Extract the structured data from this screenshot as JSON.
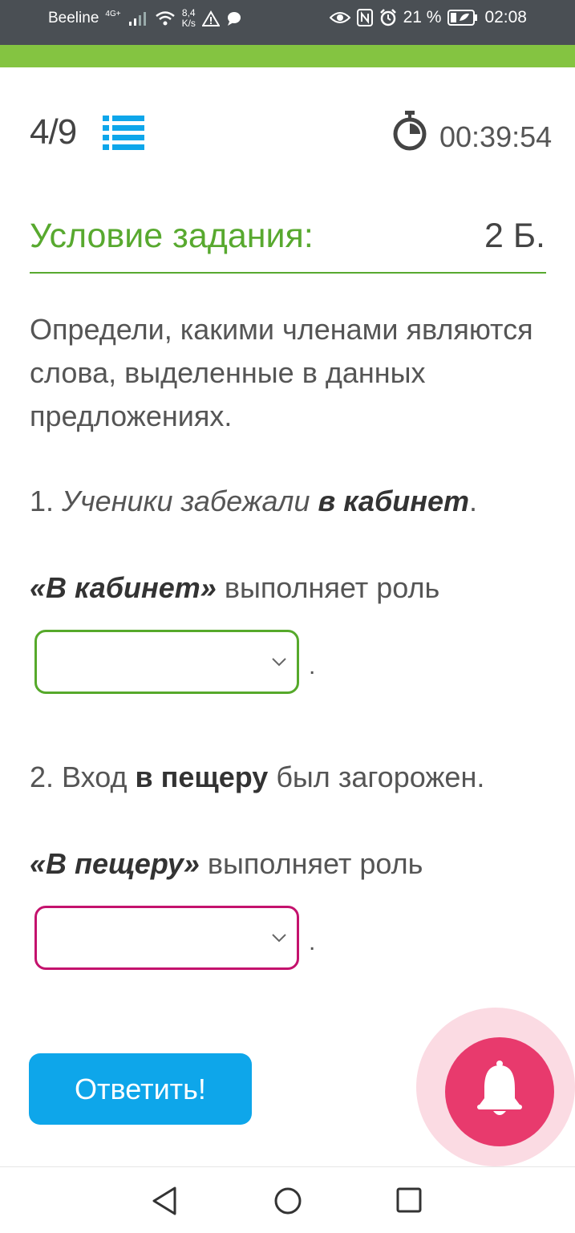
{
  "status_bar": {
    "carrier": "Beeline",
    "network": "4G+",
    "speed_value": "8,4",
    "speed_unit": "K/s",
    "battery": "21 %",
    "time": "02:08"
  },
  "header": {
    "counter_current": "4",
    "counter_total": "/9",
    "timer": "00:39:54"
  },
  "condition": {
    "title": "Условие задания:",
    "points": "2 Б."
  },
  "task": {
    "text": "Определи, какими членами являются слова, выделенные в данных предложениях.",
    "q1": {
      "number": "1. ",
      "italic": "Ученики забежали ",
      "highlight": "в кабинет",
      "end": "."
    },
    "role1": {
      "phrase": "«В кабинет»",
      "text": " выполняет роль"
    },
    "select1": {
      "value": "",
      "dot": "."
    },
    "q2": {
      "start": "2. Вход ",
      "highlight": "в пещеру",
      "end": " был загорожен."
    },
    "role2": {
      "phrase": "«В пещеру»",
      "text": " выполняет роль"
    },
    "select2": {
      "value": "",
      "dot": "."
    }
  },
  "answer_button": {
    "label": "Ответить!"
  },
  "colors": {
    "accent_green": "#58a92f",
    "top_bar_green": "#84c441",
    "button_blue": "#0ea6ea",
    "select_invalid": "#c4126d",
    "bell": "#e83a6d"
  },
  "icons": {
    "list": "list-icon",
    "timer": "stopwatch-icon",
    "chevron": "chevron-down-icon",
    "bell": "bell-icon",
    "nav_back": "back-triangle-icon",
    "nav_home": "home-circle-icon",
    "nav_recent": "recent-square-icon"
  }
}
